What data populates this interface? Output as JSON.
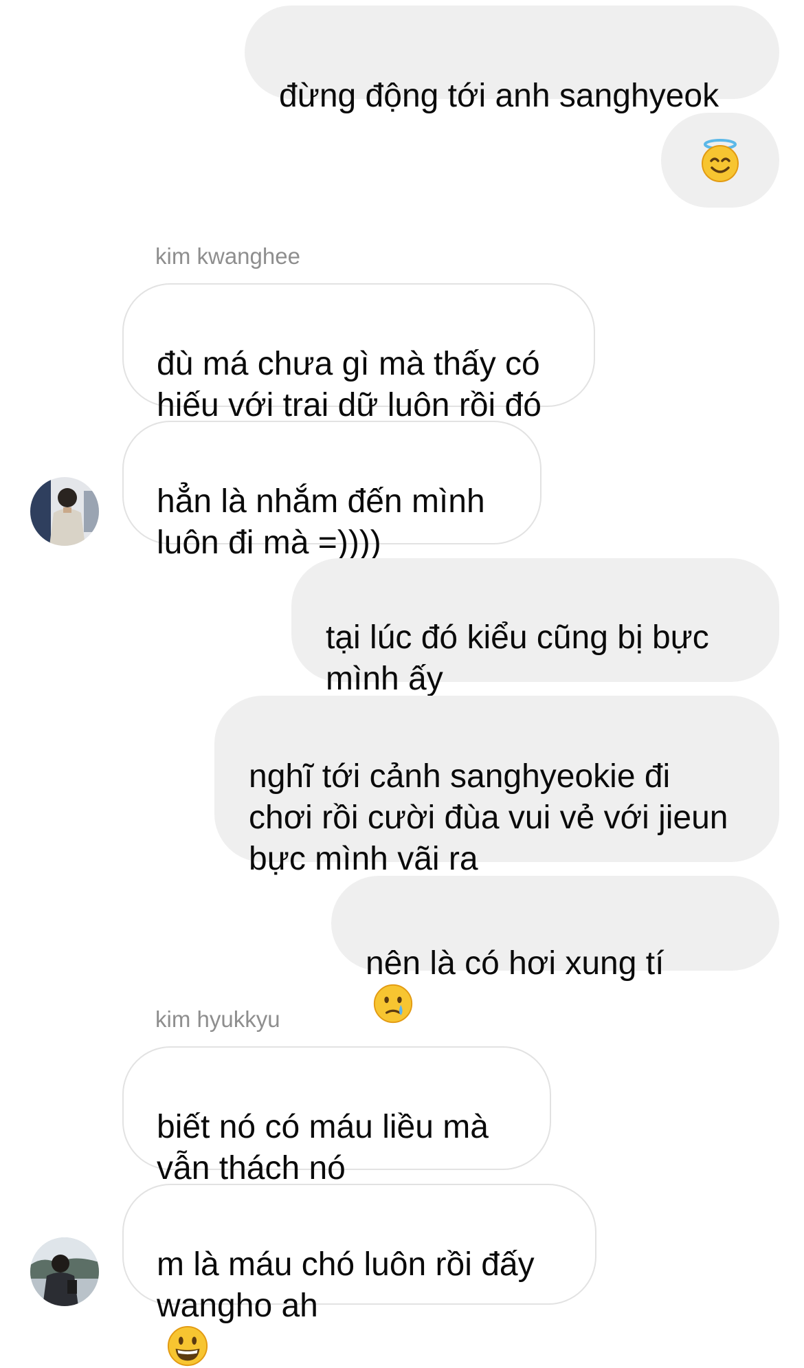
{
  "conversation": {
    "messages": [
      {
        "id": "m1",
        "from": "me",
        "text": "đừng động tới anh sanghyeok"
      },
      {
        "id": "m2",
        "from": "me",
        "emoji": "smiling-face-with-halo"
      },
      {
        "id": "m3",
        "from": "kim kwanghee",
        "text": "đù má chưa gì mà thấy có\nhiếu với trai dữ luôn rồi đó"
      },
      {
        "id": "m4",
        "from": "kim kwanghee",
        "text": "hẳn là nhắm đến mình\nluôn đi mà =))))"
      },
      {
        "id": "m5",
        "from": "me",
        "text": "tại lúc đó kiểu cũng bị bực\nmình ấy"
      },
      {
        "id": "m6",
        "from": "me",
        "text": "nghĩ tới cảnh sanghyeokie đi\nchơi rồi cười đùa vui vẻ với jieun\nbực mình vãi ra"
      },
      {
        "id": "m7",
        "from": "me",
        "text": "nên là có hơi xung tí",
        "emoji": "crying-face"
      },
      {
        "id": "m8",
        "from": "kim hyukkyu",
        "text": "biết nó có máu liều mà\nvẫn thách nó"
      },
      {
        "id": "m9",
        "from": "kim hyukkyu",
        "text": "m là máu chó luôn rồi đấy\nwangho ah",
        "emoji": "grinning-face"
      }
    ],
    "senders": {
      "kwanghee": "kim kwanghee",
      "hyukkyu": "kim hyukkyu"
    }
  },
  "colors": {
    "outgoing_bubble": "#efefef",
    "incoming_border": "#e2e2e2",
    "sender_label": "#8e8e8e",
    "text": "#0a0a0a"
  }
}
